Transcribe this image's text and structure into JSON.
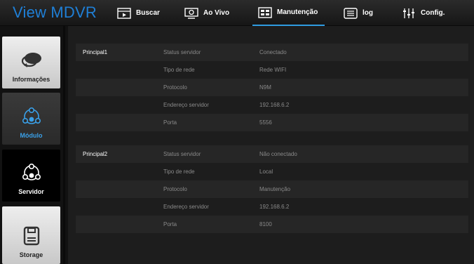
{
  "app": {
    "title": "View MDVR"
  },
  "nav": [
    {
      "label": "Buscar",
      "icon": "search-video-icon"
    },
    {
      "label": "Ao Vivo",
      "icon": "live-camera-icon"
    },
    {
      "label": "Manutenção",
      "icon": "maintenance-icon",
      "active": true
    },
    {
      "label": "log",
      "icon": "log-list-icon"
    },
    {
      "label": "Config.",
      "icon": "config-sliders-icon"
    }
  ],
  "sidebar": {
    "items": [
      {
        "label": "Informações",
        "icon": "chat-bubble-icon"
      },
      {
        "label": "Módulo",
        "icon": "module-nodes-icon"
      },
      {
        "label": "Servidor",
        "icon": "server-nodes-icon",
        "active": true
      },
      {
        "label": "Storage",
        "icon": "floppy-disk-icon"
      }
    ]
  },
  "servers": [
    {
      "name": "Principal1",
      "rows": [
        {
          "label": "Status servidor",
          "value": "Conectado"
        },
        {
          "label": "Tipo de rede",
          "value": "Rede WIFI"
        },
        {
          "label": "Protocolo",
          "value": "N9M"
        },
        {
          "label": "Endereço servidor",
          "value": "192.168.6.2"
        },
        {
          "label": "Porta",
          "value": "5556"
        }
      ]
    },
    {
      "name": "Principal2",
      "rows": [
        {
          "label": "Status servidor",
          "value": "Não conectado"
        },
        {
          "label": "Tipo de rede",
          "value": "Local"
        },
        {
          "label": "Protocolo",
          "value": "Manutenção"
        },
        {
          "label": "Endereço servidor",
          "value": "192.168.6.2"
        },
        {
          "label": "Porta",
          "value": "8100"
        }
      ]
    }
  ],
  "colors": {
    "accent": "#2f9be0",
    "brand": "#1f7fd6",
    "active_side_label": "#3aa0e8"
  }
}
